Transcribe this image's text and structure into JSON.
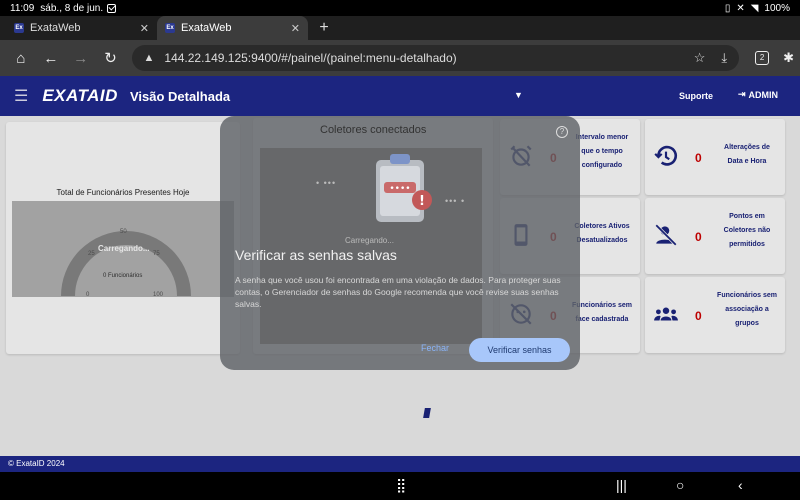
{
  "status_bar": {
    "time": "11:09",
    "date": "sáb., 8 de jun.",
    "battery": "100%"
  },
  "tabs": [
    {
      "title": "ExataWeb",
      "favicon": "Ex",
      "active": false
    },
    {
      "title": "ExataWeb",
      "favicon": "Ex",
      "active": true
    }
  ],
  "omnibox": {
    "url": "144.22.149.125:9400/#/painel/(painel:menu-detalhado)",
    "tab_count": "2"
  },
  "header": {
    "logo": "EXATAID",
    "title": "Visão Detalhada",
    "support": "Suporte",
    "admin": "ADMIN",
    "bg": "#1c2580"
  },
  "gauge": {
    "title": "Total de Funcionários Presentes Hoje",
    "loading": "Carregando...",
    "caption": "0 Funcionários",
    "ticks": [
      "0",
      "25",
      "50",
      "75",
      "100"
    ]
  },
  "stats": [
    {
      "value": "0",
      "label_lines": [
        "Intervalo menor",
        "que o tempo",
        "configurado"
      ],
      "icon": "alarm-off-icon"
    },
    {
      "value": "0",
      "label_lines": [
        "Alterações de",
        "Data e Hora"
      ],
      "icon": "history-icon"
    },
    {
      "value": "0",
      "label_lines": [
        "Coletores Ativos",
        "Desatualizados"
      ],
      "icon": "smartphone-icon"
    },
    {
      "value": "0",
      "label_lines": [
        "Pontos em",
        "Coletores não",
        "permitidos"
      ],
      "icon": "person-off-icon"
    },
    {
      "value": "0",
      "label_lines": [
        "Funcionários sem",
        "face cadastrada"
      ],
      "icon": "face-off-icon"
    },
    {
      "value": "0",
      "label_lines": [
        "Funcionários sem",
        "associação a",
        "grupos"
      ],
      "icon": "groups-icon"
    }
  ],
  "footer": {
    "text": "© ExataID 2024"
  },
  "dialog": {
    "collectors_title": "Coletores conectados",
    "collectors_loading": "Carregando...",
    "heading": "Verificar as senhas salvas",
    "body": "A senha que você usou foi encontrada em uma violação de dados. Para proteger suas contas, o Gerenciador de senhas do Google recomenda que você revise suas senhas salvas.",
    "close_label": "Fechar",
    "verify_label": "Verificar senhas",
    "password_dots": "••••",
    "alert_mark": "!"
  }
}
